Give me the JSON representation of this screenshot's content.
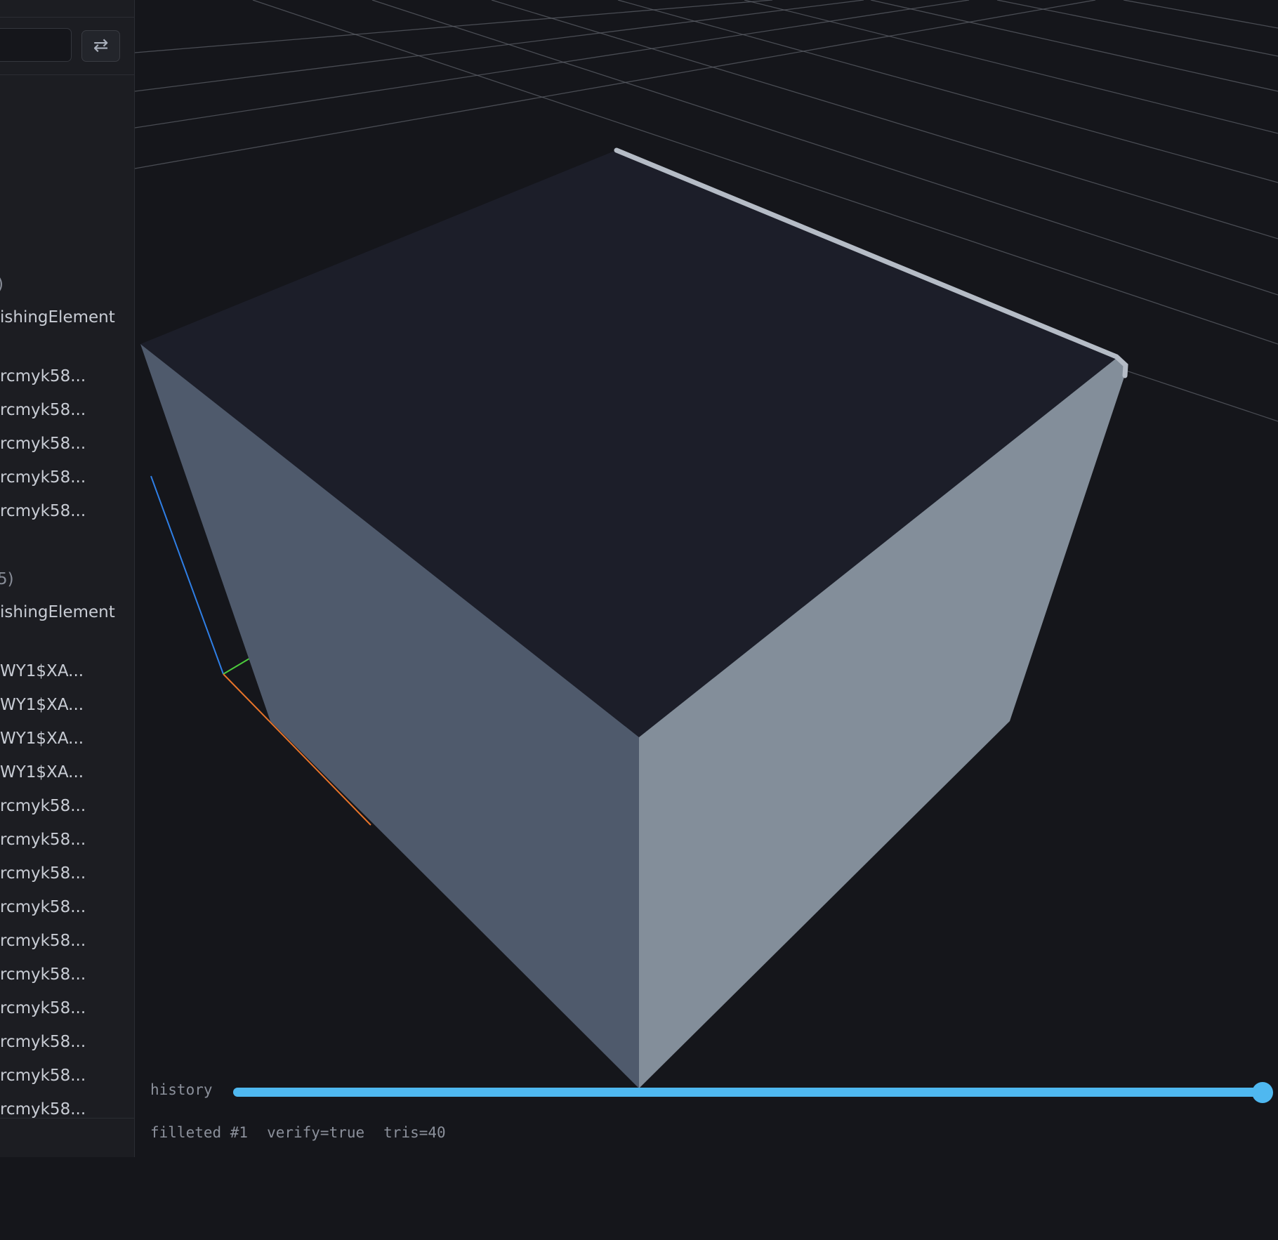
{
  "sidebar": {
    "search": {
      "value": "",
      "placeholder": ""
    },
    "swap_icon": "⇄",
    "tree": [
      {
        "label": ")",
        "kind": "group"
      },
      {
        "label": "ishingElement",
        "kind": "item"
      },
      {
        "label": "rcmyk58...",
        "kind": "item"
      },
      {
        "label": "rcmyk58...",
        "kind": "item"
      },
      {
        "label": "rcmyk58...",
        "kind": "item"
      },
      {
        "label": "rcmyk58...",
        "kind": "item"
      },
      {
        "label": "rcmyk58...",
        "kind": "item"
      },
      {
        "label": "5)",
        "kind": "group"
      },
      {
        "label": "ishingElement",
        "kind": "item"
      },
      {
        "label": "WY1$XA...",
        "kind": "item"
      },
      {
        "label": "WY1$XA...",
        "kind": "item"
      },
      {
        "label": "WY1$XA...",
        "kind": "item"
      },
      {
        "label": "WY1$XA...",
        "kind": "item"
      },
      {
        "label": "rcmyk58...",
        "kind": "item"
      },
      {
        "label": "rcmyk58...",
        "kind": "item"
      },
      {
        "label": "rcmyk58...",
        "kind": "item"
      },
      {
        "label": "rcmyk58...",
        "kind": "item"
      },
      {
        "label": "rcmyk58...",
        "kind": "item"
      },
      {
        "label": "rcmyk58...",
        "kind": "item"
      },
      {
        "label": "rcmyk58...",
        "kind": "item"
      },
      {
        "label": "rcmyk58...",
        "kind": "item"
      },
      {
        "label": "rcmyk58...",
        "kind": "item"
      },
      {
        "label": "rcmyk58...",
        "kind": "item"
      }
    ]
  },
  "viewport": {
    "background_color": "#15161b",
    "grid_color": "#5b5e66",
    "solid": {
      "top_face_color": "#1c1e29",
      "left_face_color": "#4f5a6c",
      "right_face_color": "#838e9a",
      "fillet_edge_color": "#b5bcc6"
    },
    "axes": {
      "x_color": "#e8742a",
      "y_color": "#4ccc3c",
      "z_color": "#2f7fe6"
    }
  },
  "history": {
    "label": "history",
    "value": 1.0,
    "accent_color": "#4fb8f0"
  },
  "status": {
    "step": "filleted #1",
    "verify": "verify=true",
    "tris": "tris=40"
  }
}
